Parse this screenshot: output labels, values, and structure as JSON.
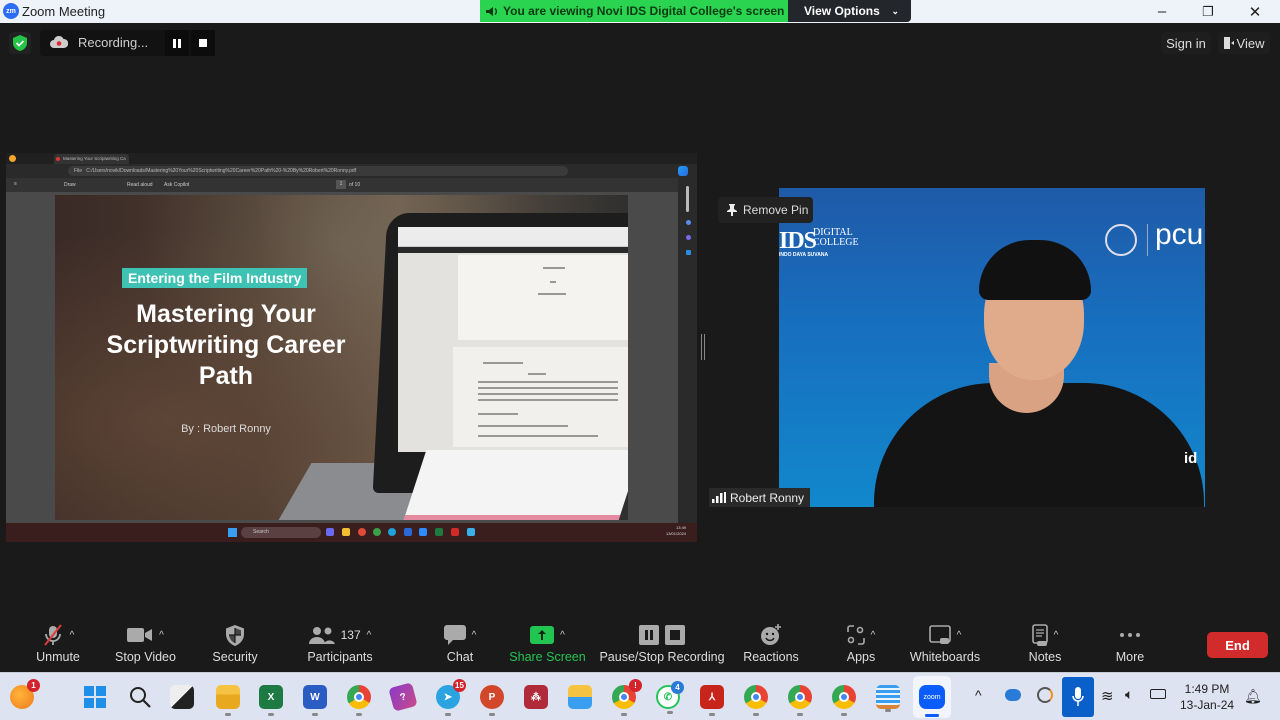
{
  "window": {
    "app_title": "Zoom Meeting",
    "logo_text": "zm",
    "banner_text": "You are viewing Novi IDS Digital College's screen",
    "view_options_label": "View Options",
    "min_icon": "–",
    "restore_icon": "❐",
    "close_icon": "✕"
  },
  "meeting_bar": {
    "recording_label": "Recording...",
    "sign_in_label": "Sign in",
    "view_label": "View"
  },
  "shared_screen": {
    "browser_tab_title": "Mastering Your Scriptwriting Ca",
    "url_prefix": "File",
    "url": "C:/Users/novik/Downloads/Mastering%20Your%20Scriptwriting%20Career%20Path%20-%20By%20Robert%20Ronny.pdf",
    "pdf_toolbar": {
      "draw_label": "Draw",
      "read_aloud_label": "Read aloud",
      "ask_copilot_label": "Ask Copilot",
      "page_current": "1",
      "page_total_label": "of 10"
    },
    "slide": {
      "tag": "Entering the Film Industry",
      "title_line1": "Mastering Your",
      "title_line2": "Scriptwriting Career",
      "title_line3": "Path",
      "byline": "By : Robert Ronny"
    },
    "win_taskbar": {
      "search_placeholder": "Search",
      "time": "13:49",
      "date": "13/01/2024"
    }
  },
  "video": {
    "remove_pin_label": "Remove Pin",
    "participant_name": "Robert Ronny",
    "ids_logo_main": "IDS",
    "ids_logo_digital": "DIGITAL",
    "ids_logo_college": "COLLEGE",
    "ids_logo_sub": "INDO DAYA SUVANA",
    "pcu_logo": "pcu",
    "id_mark": "id"
  },
  "toolbar": {
    "unmute": "Unmute",
    "stop_video": "Stop Video",
    "security": "Security",
    "participants": "Participants",
    "participants_count": "137",
    "chat": "Chat",
    "share_screen": "Share Screen",
    "pause_stop_recording": "Pause/Stop Recording",
    "reactions": "Reactions",
    "apps": "Apps",
    "whiteboards": "Whiteboards",
    "notes": "Notes",
    "more": "More",
    "end": "End",
    "caret": "^"
  },
  "taskbar": {
    "badges": {
      "notifications": "1",
      "telegram": "15",
      "chrome_profile": "!",
      "whatsapp": "4"
    },
    "zoom_label": "zoom",
    "time": "1:49 PM",
    "date": "13-Jan-24"
  },
  "colors": {
    "banner_green": "#2ad450",
    "end_red": "#d12b2b",
    "share_green": "#23c552",
    "slide_tag": "#3ec2b4"
  }
}
